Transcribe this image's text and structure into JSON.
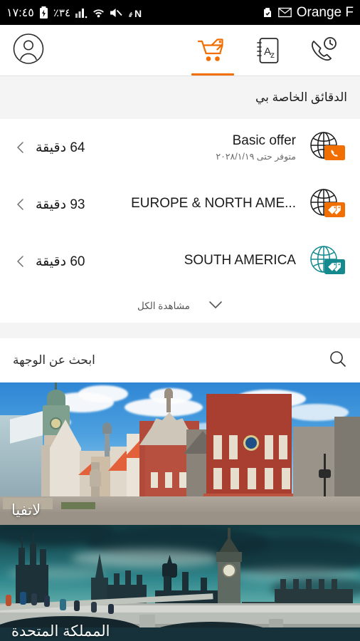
{
  "status_bar": {
    "time": "١٧:٤٥",
    "battery_percent": "٪٣٤",
    "carrier": "Orange F",
    "icons": [
      "battery-charging-icon",
      "signal-bars-icon",
      "wifi-icon",
      "mute-icon",
      "nfc-icon",
      "sd-card-icon",
      "mail-icon"
    ]
  },
  "topbar": {
    "avatar_icon": "user-avatar-icon",
    "tabs": [
      {
        "name": "tab-shop",
        "icon": "shopping-cart-tag-icon",
        "active": true
      },
      {
        "name": "tab-directory",
        "icon": "az-address-book-icon",
        "active": false
      },
      {
        "name": "tab-call-history",
        "icon": "phone-history-icon",
        "active": false
      }
    ]
  },
  "minutes_section": {
    "title": "الدقائق الخاصة بي",
    "offers": [
      {
        "name": "Basic offer",
        "subtitle": "متوفر حتى ٢٠٢٨/١/١٩",
        "amount": "64 دقيقة",
        "icon": "globe-phone-icon",
        "icon_color": "#f16e00",
        "chevron": "chevron-left-icon"
      },
      {
        "name": "EUROPE & NORTH AME...",
        "subtitle": "",
        "amount": "93 دقيقة",
        "icon": "globe-tags-icon",
        "icon_color": "#f16e00",
        "chevron": "chevron-left-icon"
      },
      {
        "name": "SOUTH AMERICA",
        "subtitle": "",
        "amount": "60 دقيقة",
        "icon": "globe-tags-icon",
        "icon_color": "#148a8f",
        "chevron": "chevron-left-icon"
      }
    ],
    "see_all_label": "مشاهدة الكل",
    "see_all_icon": "chevron-down-icon"
  },
  "search": {
    "placeholder": "ابحث عن الوجهة",
    "icon": "search-icon"
  },
  "destinations": [
    {
      "caption": "لاتفيا",
      "scene": "riga-old-town-photo"
    },
    {
      "caption": "المملكة المتحدة",
      "scene": "london-westminster-photo"
    }
  ],
  "colors": {
    "brand_orange": "#f16e00",
    "teal": "#148a8f",
    "page_bg": "#f4f4f4",
    "card_bg": "#ffffff"
  }
}
